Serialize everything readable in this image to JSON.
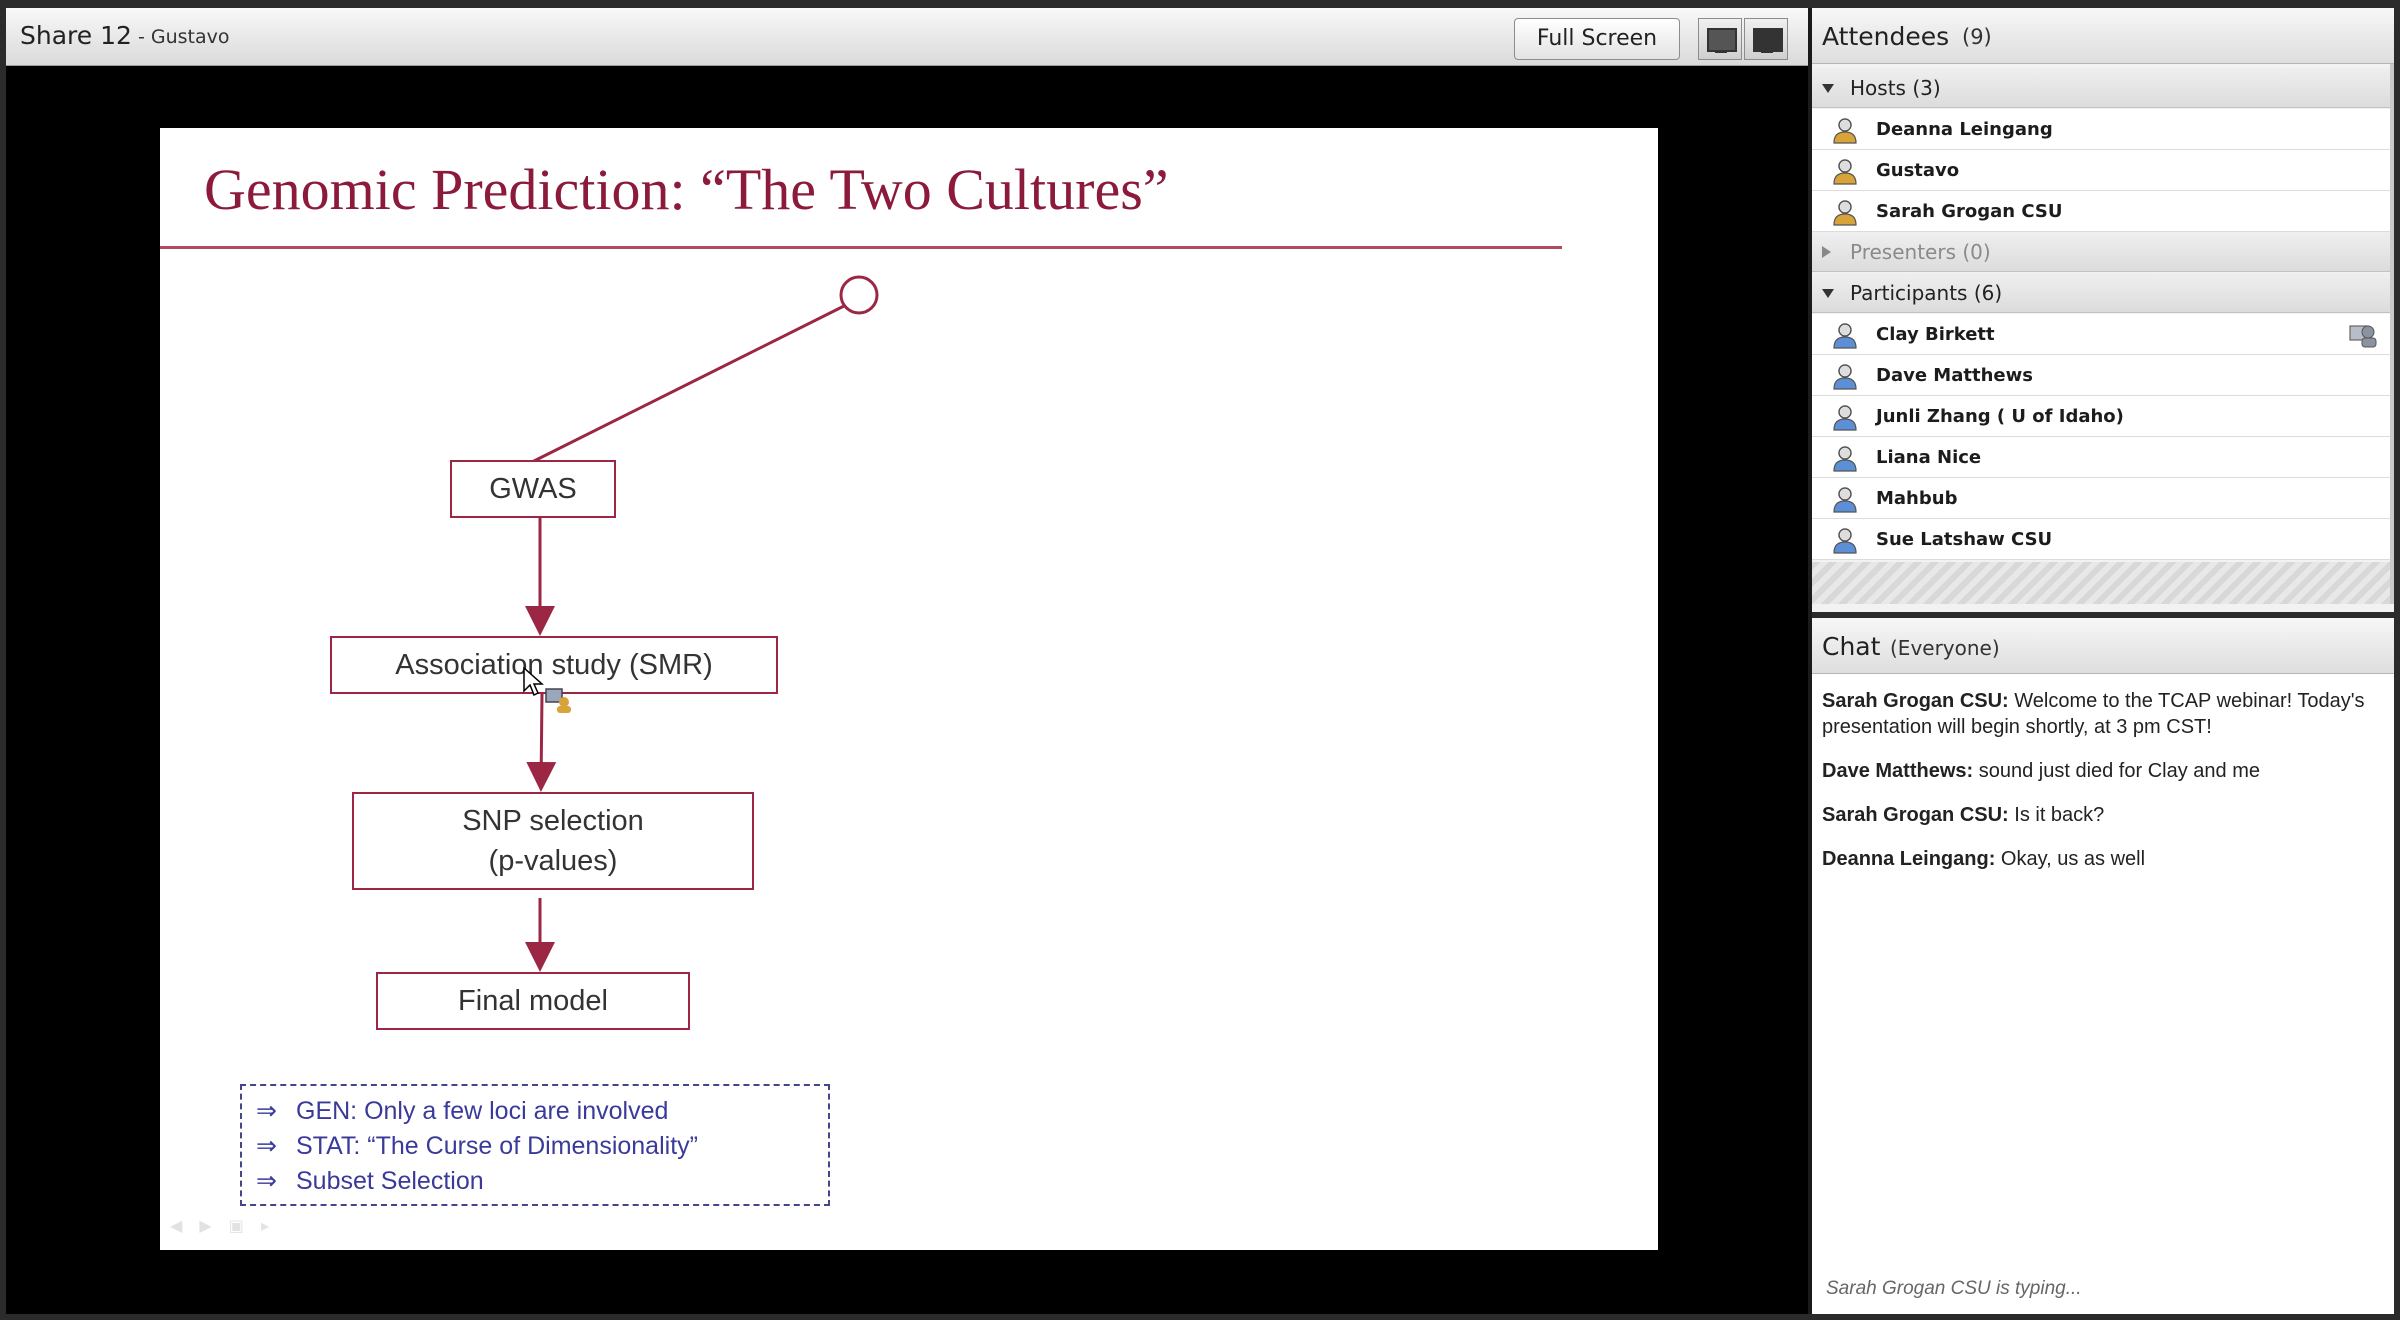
{
  "share": {
    "title": "Share 12",
    "presenter": "- Gustavo",
    "full_screen_label": "Full Screen"
  },
  "slide": {
    "title": "Genomic Prediction: “The Two Cultures”",
    "boxes": {
      "gwas": "GWAS",
      "association": "Association study (SMR)",
      "snp_line1": "SNP selection",
      "snp_line2": "(p-values)",
      "final": "Final model"
    },
    "notes": [
      "GEN: Only a few loci are involved",
      "STAT: “The Curse of Dimensionality”",
      "Subset Selection"
    ],
    "arrow_glyph": "⇒"
  },
  "attendees": {
    "title": "Attendees",
    "count": "(9)",
    "hosts_label": "Hosts (3)",
    "hosts": [
      "Deanna Leingang",
      "Gustavo",
      "Sarah Grogan CSU"
    ],
    "presenters_label": "Presenters (0)",
    "participants_label": "Participants (6)",
    "participants": [
      "Clay Birkett",
      "Dave Matthews",
      "Junli Zhang ( U of Idaho)",
      "Liana Nice",
      "Mahbub",
      "Sue Latshaw CSU"
    ]
  },
  "chat": {
    "title": "Chat",
    "scope": "(Everyone)",
    "messages": [
      {
        "sender": "Sarah Grogan CSU:",
        "text": " Welcome to the TCAP webinar! Today's presentation will begin shortly, at 3 pm CST!"
      },
      {
        "sender": "Dave Matthews:",
        "text": " sound just died for Clay and me"
      },
      {
        "sender": "Sarah Grogan CSU:",
        "text": " Is it back?"
      },
      {
        "sender": "Deanna Leingang:",
        "text": " Okay, us as well"
      }
    ],
    "typing": "Sarah Grogan CSU is typing..."
  },
  "colors": {
    "slide_accent": "#8b1a3b",
    "box_border": "#9b2745",
    "note_text": "#3a3a9a",
    "host_icon": "#d8a43a",
    "participant_icon": "#5b8fd6"
  }
}
